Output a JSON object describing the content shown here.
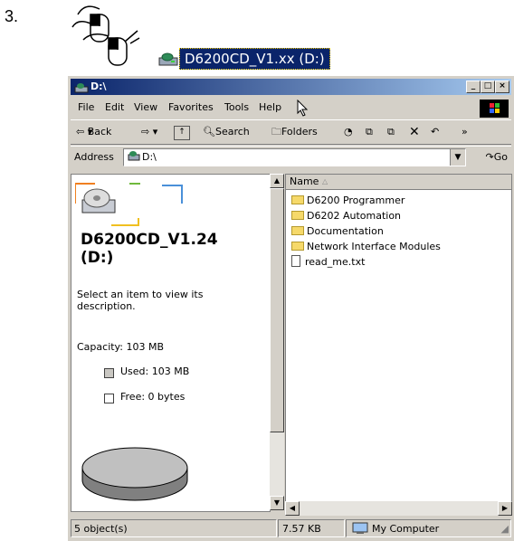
{
  "step_number": "3.",
  "drive_highlight_label": "D6200CD_V1.xx (D:)",
  "window": {
    "title": "D:\\",
    "menu": [
      "File",
      "Edit",
      "View",
      "Favorites",
      "Tools",
      "Help"
    ],
    "toolbar": {
      "back": "Back",
      "search": "Search",
      "folders": "Folders"
    },
    "address_label": "Address",
    "address_value": "D:\\",
    "go_label": "Go"
  },
  "left_pane": {
    "drive_name_line1": "D6200CD_V1.24",
    "drive_name_line2": "(D:)",
    "hint": "Select an item to view its description.",
    "capacity": "Capacity: 103 MB",
    "used": "Used: 103 MB",
    "free": "Free: 0 bytes"
  },
  "file_list": {
    "column_name": "Name",
    "items": [
      {
        "name": "D6200 Programmer",
        "type": "folder"
      },
      {
        "name": "D6202 Automation",
        "type": "folder"
      },
      {
        "name": "Documentation",
        "type": "folder"
      },
      {
        "name": "Network Interface Modules",
        "type": "folder"
      },
      {
        "name": "read_me.txt",
        "type": "file"
      }
    ]
  },
  "status_bar": {
    "objects": "5 object(s)",
    "size": "7.57 KB",
    "location": "My Computer"
  },
  "icons": [
    "mouse-double-click-icon",
    "drive-icon",
    "cd-drive-icon",
    "folder-icon",
    "text-file-icon",
    "windows-logo-icon",
    "computer-icon",
    "pie-disk-icon"
  ]
}
